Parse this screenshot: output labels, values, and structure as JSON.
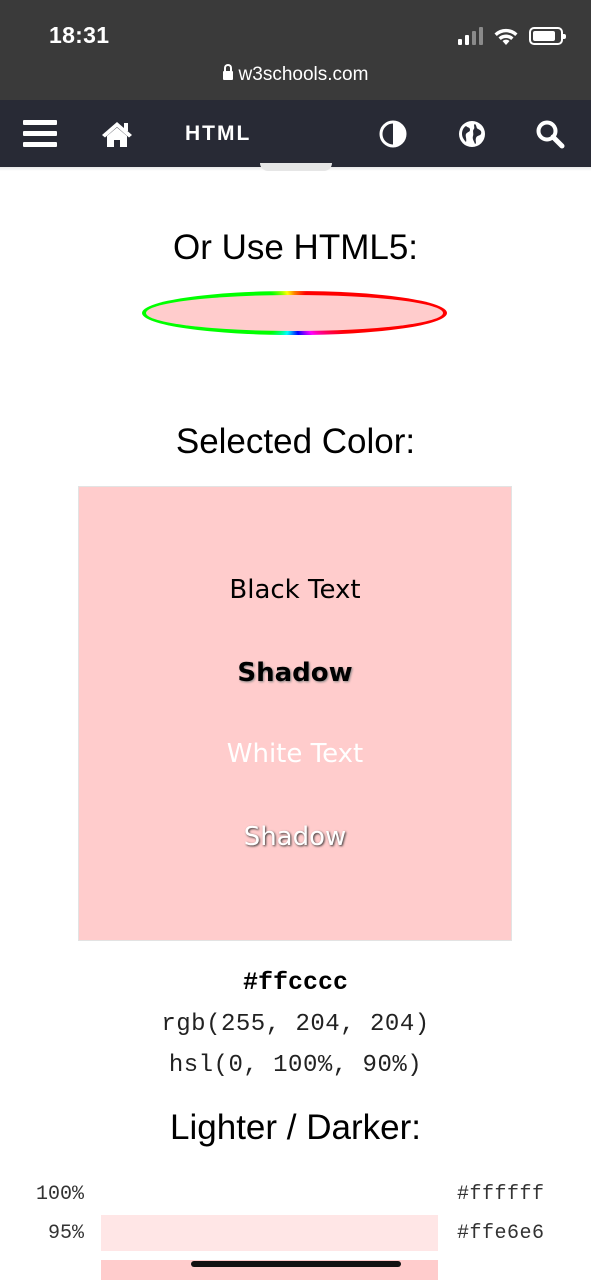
{
  "status_bar": {
    "time": "18:31",
    "url": "w3schools.com",
    "icons": [
      "signal-icon",
      "wifi-icon",
      "battery-icon"
    ]
  },
  "navbar": {
    "title": "HTML",
    "icons": [
      "hamburger-menu-icon",
      "home-icon",
      "contrast-icon",
      "globe-icon",
      "search-icon"
    ],
    "background": "#282a35"
  },
  "html5_section": {
    "heading": "Or Use HTML5:",
    "input_value": "#ffcccc"
  },
  "selected_section": {
    "heading": "Selected Color:",
    "color": "#ffcccc",
    "samples": {
      "black_text": "Black Text",
      "black_shadow": "Shadow",
      "white_text": "White Text",
      "white_shadow": "Shadow"
    }
  },
  "color_values": {
    "hex": "#ffcccc",
    "rgb": "rgb(255, 204, 204)",
    "hsl": "hsl(0, 100%, 90%)"
  },
  "lighter_darker": {
    "heading": "Lighter / Darker:",
    "rows": [
      {
        "percent": "100%",
        "hex": "#ffffff",
        "color": "#ffffff"
      },
      {
        "percent": "95%",
        "hex": "#ffe6e6",
        "color": "#ffe6e6"
      },
      {
        "percent": "",
        "hex": "",
        "color": "#ffcccc"
      }
    ]
  }
}
